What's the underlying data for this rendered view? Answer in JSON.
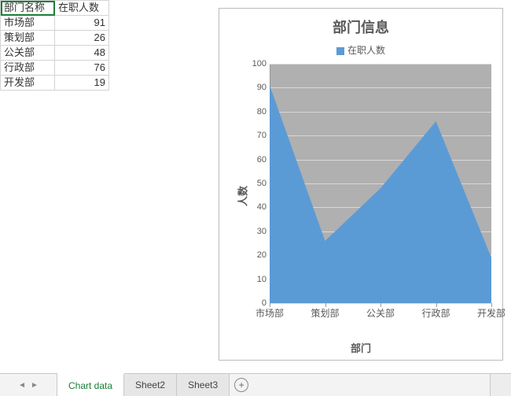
{
  "table": {
    "headers": [
      "部门名称",
      "在职人数"
    ],
    "rows": [
      {
        "dept": "市场部",
        "count": 91
      },
      {
        "dept": "策划部",
        "count": 26
      },
      {
        "dept": "公关部",
        "count": 48
      },
      {
        "dept": "行政部",
        "count": 76
      },
      {
        "dept": "开发部",
        "count": 19
      }
    ]
  },
  "chart_data": {
    "type": "area",
    "title": "部门信息",
    "legend": "在职人数",
    "xlabel": "部门",
    "ylabel": "人数",
    "ylim": [
      0,
      100
    ],
    "yticks": [
      0,
      10,
      20,
      30,
      40,
      50,
      60,
      70,
      80,
      90,
      100
    ],
    "categories": [
      "市场部",
      "策划部",
      "公关部",
      "行政部",
      "开发部"
    ],
    "values": [
      91,
      26,
      48,
      76,
      19
    ],
    "grid": true,
    "legend_position": "top",
    "series_color": "#5b9bd5",
    "plot_bg_color": "#b0b0b0"
  },
  "tabs": {
    "items": [
      "Chart data",
      "Sheet2",
      "Sheet3"
    ],
    "active_index": 0
  }
}
